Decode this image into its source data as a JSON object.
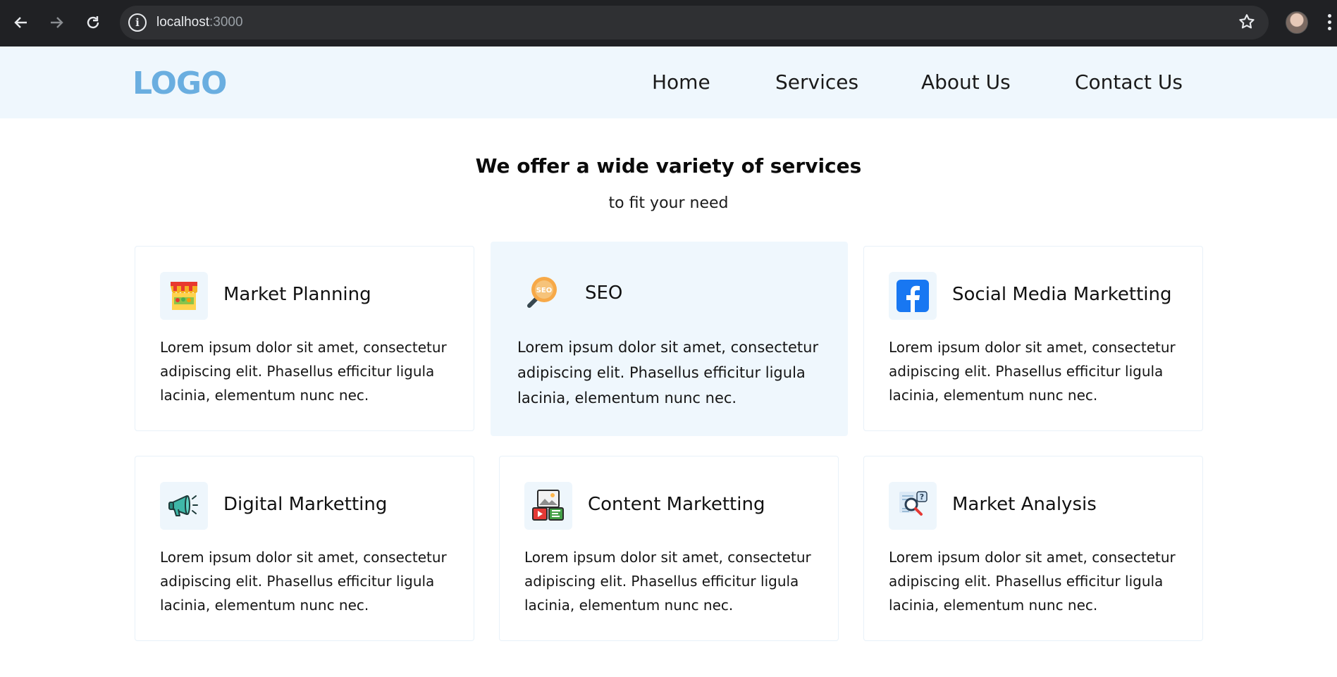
{
  "browser": {
    "url_host": "localhost",
    "url_port": ":3000",
    "icons": [
      "back-arrow-icon",
      "forward-arrow-icon",
      "reload-icon",
      "site-info-icon",
      "bookmark-star-icon",
      "profile-avatar",
      "more-menu-icon"
    ]
  },
  "header": {
    "logo": "LOGO",
    "nav": [
      "Home",
      "Services",
      "About Us",
      "Contact Us"
    ]
  },
  "hero": {
    "title": "We offer a wide variety of services",
    "subtitle": "to fit your need"
  },
  "colors": {
    "header_bg": "#eff7fd",
    "logo": "#6aaee0",
    "highlight_card_bg": "#eff7fd",
    "card_border": "#e8f1f9"
  },
  "services": [
    {
      "title": "Market Planning",
      "icon": "market-stall-icon",
      "lines": [
        "Lorem ipsum dolor sit amet, consectetur",
        "adipiscing elit. Phasellus efficitur ligula",
        "lacinia, elementum nunc nec."
      ]
    },
    {
      "title": "SEO",
      "icon": "seo-magnifier-icon",
      "lines": [
        "Lorem ipsum dolor sit amet, consectetur",
        "adipiscing elit. Phasellus efficitur ligula",
        "lacinia, elementum nunc nec."
      ]
    },
    {
      "title": "Social Media Marketting",
      "icon": "facebook-icon",
      "lines": [
        "Lorem ipsum dolor sit amet, consectetur",
        "adipiscing elit. Phasellus efficitur ligula",
        "lacinia, elementum nunc nec."
      ]
    },
    {
      "title": "Digital Marketting",
      "icon": "megaphone-icon",
      "lines": [
        "Lorem ipsum dolor sit amet, consectetur",
        "adipiscing elit. Phasellus efficitur ligula",
        "lacinia, elementum nunc nec."
      ]
    },
    {
      "title": "Content Marketting",
      "icon": "media-content-icon",
      "lines": [
        "Lorem ipsum dolor sit amet, consectetur",
        "adipiscing elit. Phasellus efficitur ligula",
        "lacinia, elementum nunc nec."
      ]
    },
    {
      "title": "Market Analysis",
      "icon": "analysis-report-icon",
      "lines": [
        "Lorem ipsum dolor sit amet, consectetur",
        "adipiscing elit. Phasellus efficitur ligula",
        "lacinia, elementum nunc nec."
      ]
    }
  ]
}
